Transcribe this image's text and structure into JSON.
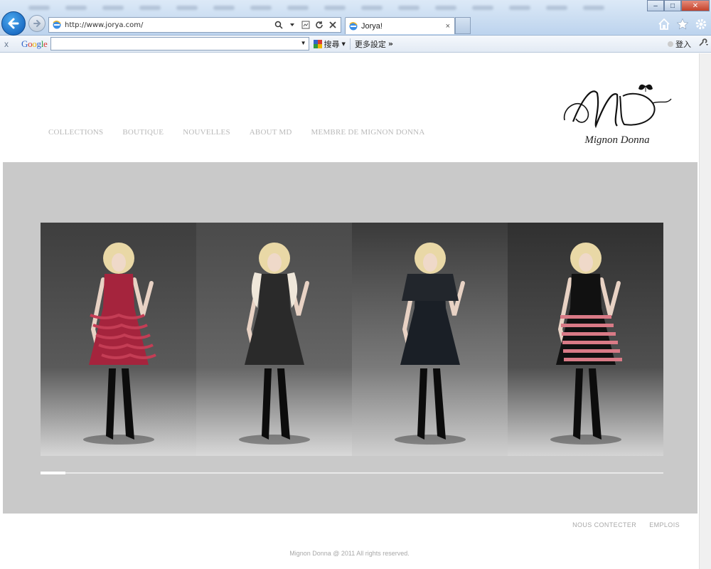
{
  "browser": {
    "url": "http://www.jorya.com/",
    "tab_title": "Jorya!",
    "tab_close": "×",
    "win_minimize": "–",
    "win_maximize": "□",
    "win_close": "✕",
    "toolbar": {
      "close": "x",
      "search_label": "搜尋",
      "more_settings": "更多設定",
      "more_arrows": "»",
      "signin": "登入"
    }
  },
  "site": {
    "logo_monogram": "MD",
    "logo_name": "Mignon Donna",
    "nav": [
      {
        "label": "COLLECTIONS"
      },
      {
        "label": "BOUTIQUE"
      },
      {
        "label": "NOUVELLES"
      },
      {
        "label": "ABOUT MD"
      },
      {
        "label": "MEMBRE DE MIGNON DONNA"
      }
    ],
    "slideshow": {
      "progress": 0.04,
      "panels": [
        {
          "dress_color": "#a5243d",
          "accent_color": "#c43d55",
          "style": "ruffle"
        },
        {
          "dress_color": "#2a2a2a",
          "accent_color": "#efe7da",
          "style": "fur"
        },
        {
          "dress_color": "#1a1f26",
          "accent_color": "#22262c",
          "style": "cape"
        },
        {
          "dress_color": "#111111",
          "accent_color": "#d97a86",
          "style": "stripe"
        }
      ]
    },
    "footer": {
      "links": [
        {
          "label": "NOUS CONTECTER"
        },
        {
          "label": "EMPLOIS"
        }
      ],
      "copyright": "Mignon Donna @ 2011 All rights reserved."
    }
  },
  "colors": {
    "hero_bg": "#c9c9c9",
    "nav_text": "#b9b9b9",
    "footer_text": "#a8a8a8"
  }
}
